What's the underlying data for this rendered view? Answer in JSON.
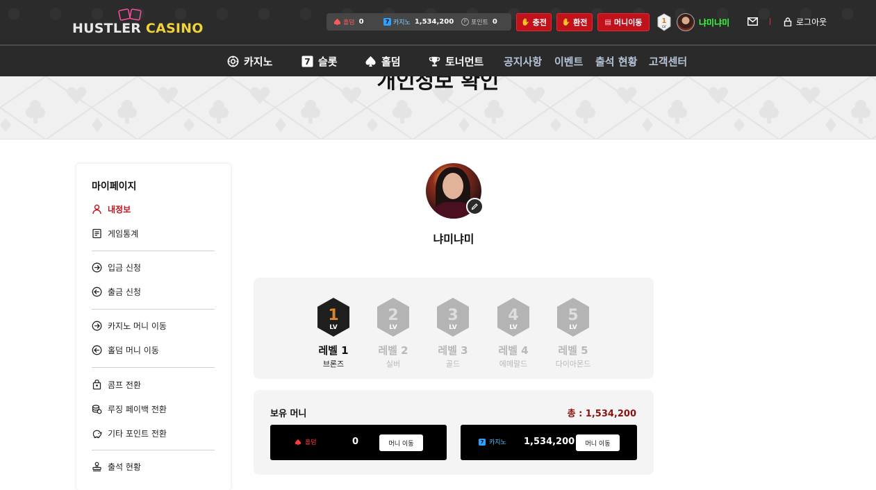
{
  "header": {
    "logo": {
      "word1": "HUSTLER",
      "word2": "CASINO"
    },
    "balances": {
      "holdem": {
        "label": "홀덤",
        "value": "0"
      },
      "casino": {
        "label": "카지노",
        "value": "1,534,200",
        "icon_text": "7"
      },
      "point": {
        "label": "포인트",
        "value": "0",
        "icon_text": "P"
      }
    },
    "buttons": {
      "charge": "충전",
      "exchange": "환전",
      "money_move": "머니이동"
    },
    "level_badge": "1",
    "level_badge_sub": "LV",
    "nickname": "냐미냐미",
    "logout": "로그아웃",
    "colors": {
      "accent_red": "#c1121b",
      "nick_green": "#3bff3b",
      "logo_yellow": "#f0d23c"
    }
  },
  "nav": {
    "items": [
      {
        "label": "카지노",
        "icon": "casino-chip-icon"
      },
      {
        "label": "슬롯",
        "icon": "slot-seven-icon",
        "icon_text": "7"
      },
      {
        "label": "홀덤",
        "icon": "spade-icon"
      },
      {
        "label": "토너먼트",
        "icon": "trophy-icon"
      },
      {
        "label": "공지사항"
      },
      {
        "label": "이벤트"
      },
      {
        "label": "출석 현황"
      },
      {
        "label": "고객센터"
      }
    ]
  },
  "hero": {
    "title": "개인정보 확인"
  },
  "sidebar": {
    "title": "마이페이지",
    "items": [
      {
        "label": "내정보",
        "icon": "user-icon",
        "active": true
      },
      {
        "label": "게임통계",
        "icon": "document-icon"
      },
      {
        "label": "입금 신청",
        "icon": "arrow-right-circle-icon"
      },
      {
        "label": "출금 신청",
        "icon": "arrow-left-circle-icon"
      },
      {
        "label": "카지노 머니 이동",
        "icon": "arrow-right-circle-icon"
      },
      {
        "label": "홀덤 머니 이동",
        "icon": "arrow-left-circle-icon"
      },
      {
        "label": "콤프 전환",
        "icon": "bag-icon"
      },
      {
        "label": "루징 페이백 전환",
        "icon": "coins-icon"
      },
      {
        "label": "기타 포인트 전환",
        "icon": "piggy-icon"
      },
      {
        "label": "출석 현황",
        "icon": "stamp-icon"
      }
    ]
  },
  "profile": {
    "nickname": "냐미냐미"
  },
  "levels": [
    {
      "num": "1",
      "badge": "LV",
      "name": "레벨 1",
      "tier": "브론즈",
      "current": true
    },
    {
      "num": "2",
      "badge": "LV",
      "name": "레벨 2",
      "tier": "실버",
      "current": false
    },
    {
      "num": "3",
      "badge": "LV",
      "name": "레벨 3",
      "tier": "골드",
      "current": false
    },
    {
      "num": "4",
      "badge": "LV",
      "name": "레벨 4",
      "tier": "에메랄드",
      "current": false
    },
    {
      "num": "5",
      "badge": "LV",
      "name": "레벨 5",
      "tier": "다이아몬드",
      "current": false
    }
  ],
  "money": {
    "title": "보유 머니",
    "total": "총 : 1,534,200",
    "wallets": [
      {
        "label": "홀덤",
        "value": "0",
        "button": "머니 이동",
        "label_color": "#ff3b3b"
      },
      {
        "label": "카지노",
        "value": "1,534,200",
        "button": "머니 이동",
        "label_color": "#4fc3ff",
        "icon_text": "7"
      }
    ]
  }
}
